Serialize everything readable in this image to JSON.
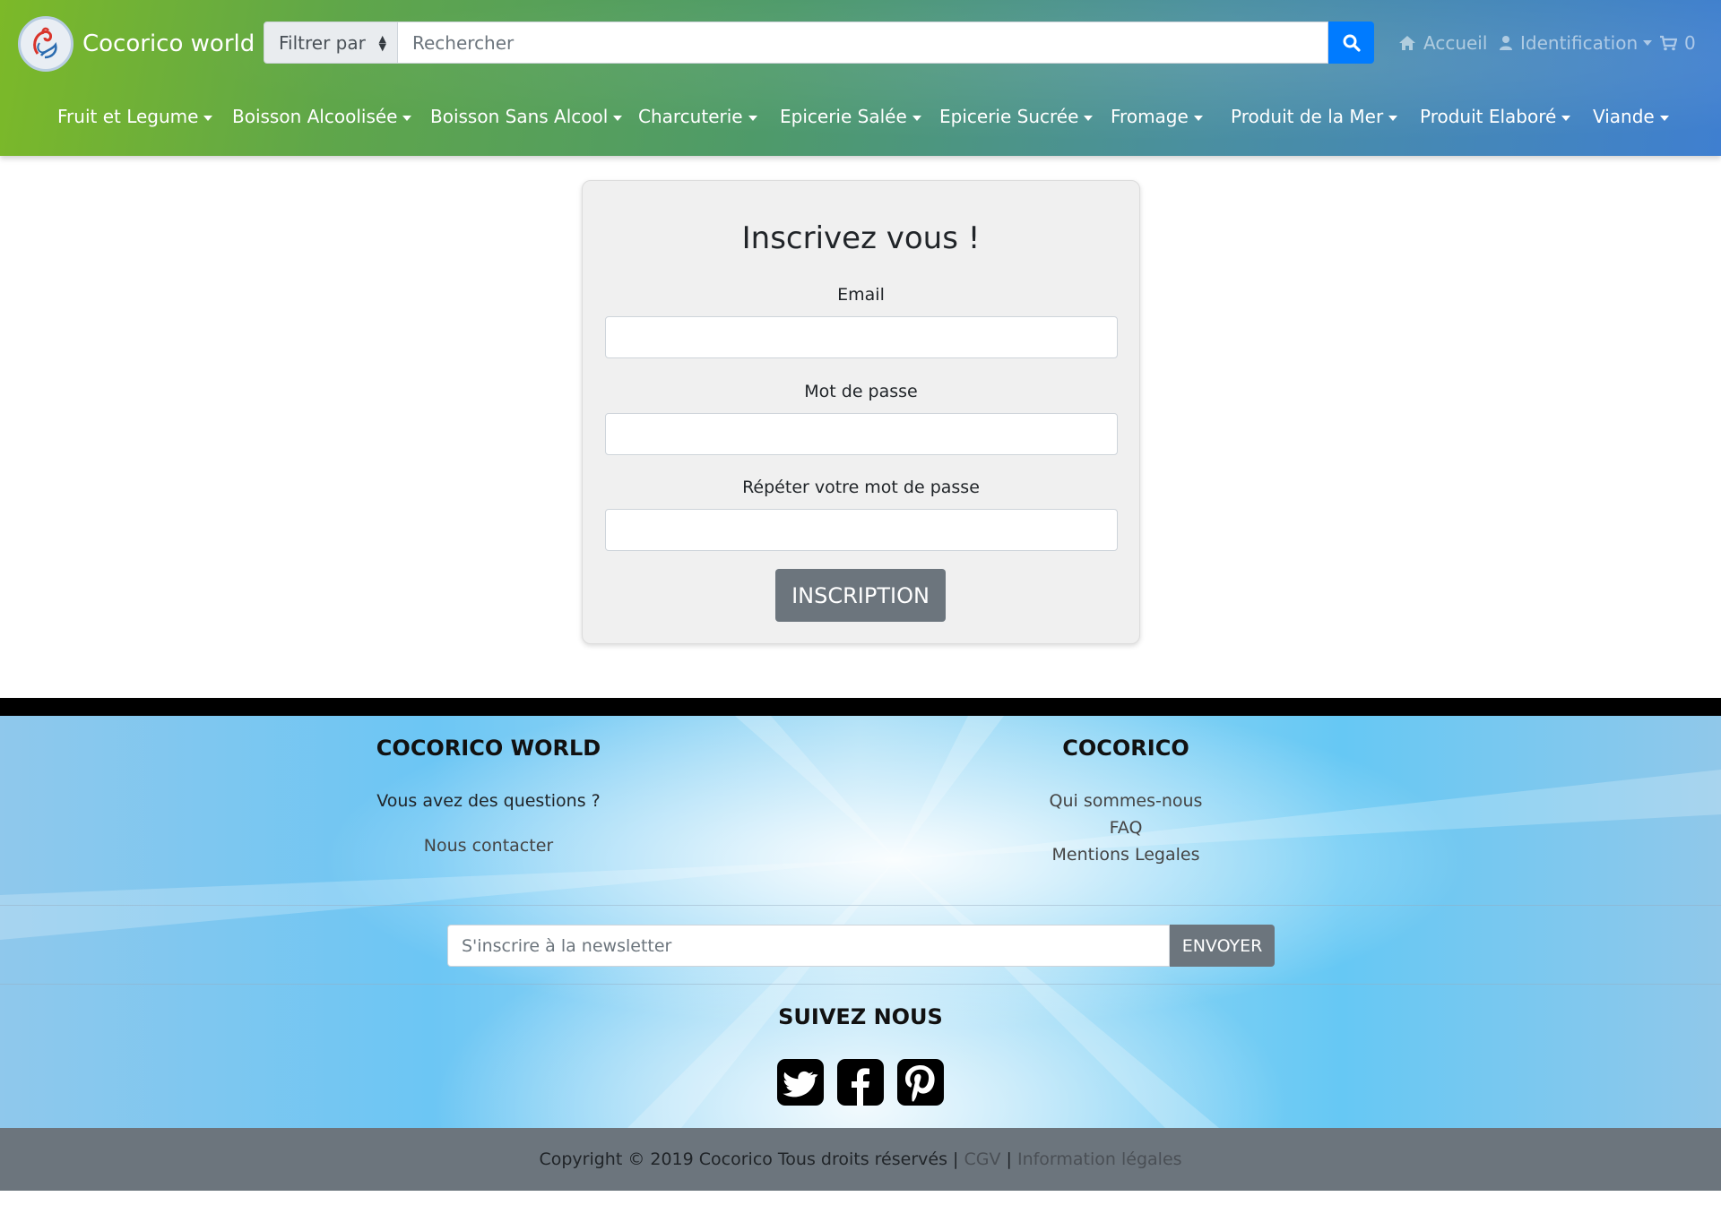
{
  "header": {
    "brand": "Cocorico world",
    "filter_label": "Filtrer par",
    "search_placeholder": "Rechercher",
    "nav": {
      "home": "Accueil",
      "login": "Identification",
      "cart_count": "0"
    },
    "categories": [
      "Fruit et Legume",
      "Boisson Alcoolisée",
      "Boisson Sans Alcool",
      "Charcuterie",
      "Epicerie Salée",
      "Epicerie Sucrée",
      "Fromage",
      "Produit de la Mer",
      "Produit Elaboré",
      "Viande"
    ],
    "icons": {
      "home": "home-icon",
      "user": "user-icon",
      "cart": "cart-icon",
      "search": "search-icon"
    }
  },
  "form": {
    "title": "Inscrivez vous !",
    "email_label": "Email",
    "email_value": "",
    "password_label": "Mot de passe",
    "password_value": "",
    "repeat_label": "Répéter votre mot de passe",
    "repeat_value": "",
    "submit": "INSCRIPTION"
  },
  "footer": {
    "col1": {
      "heading": "COCORICO WORLD",
      "question": "Vous avez des questions ?",
      "contact": "Nous contacter"
    },
    "col2": {
      "heading": "COCORICO",
      "links": [
        "Qui sommes-nous",
        "FAQ",
        "Mentions Legales"
      ]
    },
    "newsletter": {
      "placeholder": "S'inscrire à la newsletter",
      "button": "ENVOYER"
    },
    "follow": {
      "heading": "SUIVEZ NOUS",
      "icons": [
        "twitter-icon",
        "facebook-icon",
        "pinterest-icon"
      ]
    },
    "copyright": {
      "text": "Copyright © 2019 Cocorico Tous droits réservés |",
      "cgv": "CGV",
      "sep": "|",
      "legal": "Information légales"
    }
  },
  "colors": {
    "primary": "#007bff",
    "secondary": "#6c757d",
    "footer_bar": "#000000"
  }
}
